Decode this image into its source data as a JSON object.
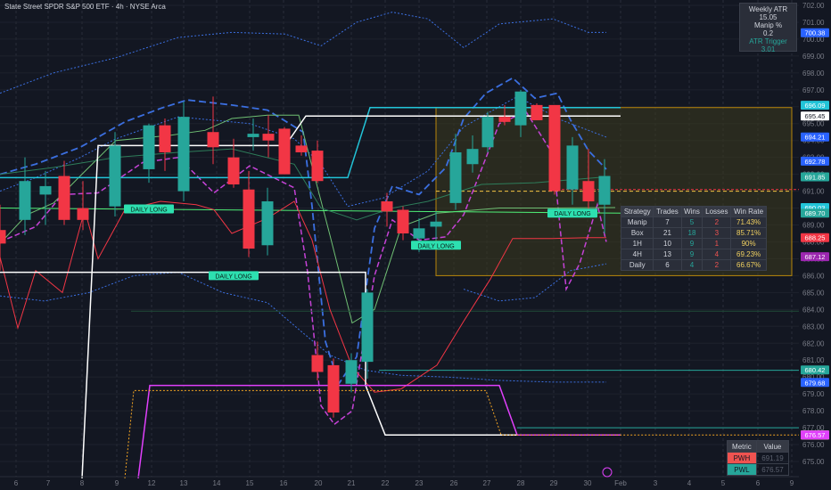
{
  "header": {
    "title": "State Street SPDR S&P 500 ETF · 4h · NYSE Arca"
  },
  "atr_panel": {
    "weekly_atr_label": "Weekly ATR",
    "weekly_atr_value": "15.05",
    "manip_label": "Manip %",
    "manip_value": "0.2",
    "trigger_label": "ATR Trigger",
    "trigger_value": "3.01"
  },
  "strategy_table": {
    "headers": [
      "Strategy",
      "Trades",
      "Wins",
      "Losses",
      "Win Rate"
    ],
    "rows": [
      [
        "Manip",
        "7",
        "5",
        "2",
        "71.43%"
      ],
      [
        "Box",
        "21",
        "18",
        "3",
        "85.71%"
      ],
      [
        "1H",
        "10",
        "9",
        "1",
        "90%"
      ],
      [
        "4H",
        "13",
        "9",
        "4",
        "69.23%"
      ],
      [
        "Daily",
        "6",
        "4",
        "2",
        "66.67%"
      ]
    ]
  },
  "metric_table": {
    "headers": [
      "Metric",
      "Value"
    ],
    "rows": [
      [
        "PWH",
        "691.19"
      ],
      [
        "PWL",
        "676.57"
      ]
    ]
  },
  "colors": {
    "up": "#26a69a",
    "down": "#f23645",
    "box_fill": "#3d3a1e",
    "box_border": "#b8860b",
    "white_line": "#ffffff",
    "cyan_line": "#22c4d8",
    "magenta_line": "#e040fb",
    "green_line": "#4caf50",
    "red_line": "#f23645",
    "blue_dash": "#3b6fe0"
  },
  "chart_data": {
    "type": "candlestick",
    "ylim": [
      674.8,
      702.4
    ],
    "y_ticks": [
      "702.00",
      "701.00",
      "700.00",
      "699.00",
      "698.00",
      "697.00",
      "696.00",
      "695.00",
      "694.00",
      "693.00",
      "692.00",
      "691.00",
      "690.00",
      "689.00",
      "688.00",
      "687.00",
      "686.00",
      "685.00",
      "684.00",
      "683.00",
      "682.00",
      "681.00",
      "680.00",
      "679.00",
      "678.00",
      "677.00",
      "676.00",
      "675.00"
    ],
    "x_ticks": [
      "6",
      "7",
      "8",
      "9",
      "12",
      "13",
      "14",
      "15",
      "16",
      "20",
      "21",
      "22",
      "23",
      "26",
      "27",
      "28",
      "29",
      "30",
      "Feb",
      "3",
      "4",
      "5",
      "6",
      "9"
    ],
    "candles": [
      {
        "o": 688.7,
        "h": 690.2,
        "l": 686.3,
        "c": 687.9
      },
      {
        "o": 689.3,
        "h": 693.0,
        "l": 688.4,
        "c": 691.6
      },
      {
        "o": 690.8,
        "h": 692.2,
        "l": 689.0,
        "c": 691.3
      },
      {
        "o": 691.9,
        "h": 692.8,
        "l": 689.0,
        "c": 689.3
      },
      {
        "o": 690.0,
        "h": 691.6,
        "l": 688.7,
        "c": 689.3
      },
      {
        "o": 690.1,
        "h": 694.5,
        "l": 689.5,
        "c": 693.7
      },
      {
        "o": 692.3,
        "h": 695.0,
        "l": 691.5,
        "c": 694.9
      },
      {
        "o": 694.9,
        "h": 695.3,
        "l": 692.2,
        "c": 693.3
      },
      {
        "o": 691.0,
        "h": 696.3,
        "l": 690.4,
        "c": 695.4
      },
      {
        "o": 694.5,
        "h": 696.6,
        "l": 692.6,
        "c": 693.6
      },
      {
        "o": 693.0,
        "h": 694.1,
        "l": 691.2,
        "c": 691.4
      },
      {
        "o": 691.1,
        "h": 692.2,
        "l": 687.1,
        "c": 687.6
      },
      {
        "o": 687.8,
        "h": 691.2,
        "l": 687.2,
        "c": 690.4
      },
      {
        "o": 694.2,
        "h": 695.3,
        "l": 693.4,
        "c": 694.4
      },
      {
        "o": 694.4,
        "h": 695.5,
        "l": 693.0,
        "c": 694.0
      },
      {
        "o": 694.7,
        "h": 694.8,
        "l": 692.0,
        "c": 692.0
      },
      {
        "o": 693.7,
        "h": 694.3,
        "l": 693.1,
        "c": 693.3
      },
      {
        "o": 693.4,
        "h": 694.0,
        "l": 691.5,
        "c": 691.6
      },
      {
        "o": 681.3,
        "h": 682.1,
        "l": 679.8,
        "c": 680.3
      },
      {
        "o": 680.7,
        "h": 681.1,
        "l": 677.6,
        "c": 677.9
      },
      {
        "o": 679.6,
        "h": 681.4,
        "l": 679.1,
        "c": 681.0
      },
      {
        "o": 680.9,
        "h": 685.2,
        "l": 679.9,
        "c": 685.0
      },
      {
        "o": 690.4,
        "h": 690.9,
        "l": 688.9,
        "c": 689.8
      },
      {
        "o": 689.9,
        "h": 690.1,
        "l": 688.1,
        "c": 688.5
      },
      {
        "o": 688.2,
        "h": 689.4,
        "l": 687.4,
        "c": 688.8
      },
      {
        "o": 688.9,
        "h": 689.8,
        "l": 688.1,
        "c": 689.2
      },
      {
        "o": 690.3,
        "h": 694.4,
        "l": 689.9,
        "c": 693.3
      },
      {
        "o": 692.6,
        "h": 694.3,
        "l": 692.1,
        "c": 693.5
      },
      {
        "o": 693.6,
        "h": 695.7,
        "l": 693.3,
        "c": 695.4
      },
      {
        "o": 695.4,
        "h": 696.1,
        "l": 694.9,
        "c": 695.1
      },
      {
        "o": 694.9,
        "h": 697.0,
        "l": 694.2,
        "c": 696.9
      },
      {
        "o": 696.1,
        "h": 696.2,
        "l": 695.2,
        "c": 695.2
      },
      {
        "o": 696.1,
        "h": 696.1,
        "l": 690.8,
        "c": 691.0
      },
      {
        "o": 691.1,
        "h": 694.2,
        "l": 690.2,
        "c": 693.7
      },
      {
        "o": 691.6,
        "h": 693.5,
        "l": 689.7,
        "c": 690.4
      },
      {
        "o": 690.2,
        "h": 692.9,
        "l": 688.5,
        "c": 691.9
      }
    ],
    "candle_x": [
      0,
      28,
      51,
      72,
      93,
      129,
      167,
      185,
      206,
      239,
      262,
      279,
      300,
      284,
      301,
      319,
      338,
      356,
      356,
      374,
      394,
      412,
      434,
      452,
      470,
      489,
      511,
      530,
      547,
      566,
      584,
      602,
      622,
      642,
      660,
      678
    ],
    "box": {
      "x1": 489,
      "x2": 888,
      "y_top": 695.95,
      "y_bottom": 686.0
    },
    "price_labels": [
      {
        "value": "700.38",
        "color": "#2962ff"
      },
      {
        "value": "696.09",
        "color": "#22c4d8"
      },
      {
        "value": "695.45",
        "color": "#ffffff"
      },
      {
        "value": "694.21",
        "color": "#2962ff"
      },
      {
        "value": "692.78",
        "color": "#2962ff"
      },
      {
        "value": "691.85",
        "color": "#26a69a"
      },
      {
        "value": "690.03",
        "color": "#22c4d8"
      },
      {
        "value": "689.70",
        "color": "#26a69a"
      },
      {
        "value": "688.25",
        "color": "#f23645"
      },
      {
        "value": "687.12",
        "color": "#9c27b0"
      },
      {
        "value": "680.42",
        "color": "#26a69a"
      },
      {
        "value": "679.68",
        "color": "#2962ff"
      },
      {
        "value": "676.57",
        "color": "#f5a623"
      },
      {
        "value": "676.57",
        "color": "#ffffff"
      },
      {
        "value": "676.57",
        "color": "#e040fb"
      }
    ],
    "signals": [
      {
        "label": "DAILY LONG",
        "x": 167,
        "value": 689.95
      },
      {
        "label": "DAILY LONG",
        "x": 262,
        "value": 686.0
      },
      {
        "label": "DAILY LONG",
        "x": 489,
        "value": 687.8
      },
      {
        "label": "DAILY LONG",
        "x": 642,
        "value": 689.7
      }
    ]
  }
}
